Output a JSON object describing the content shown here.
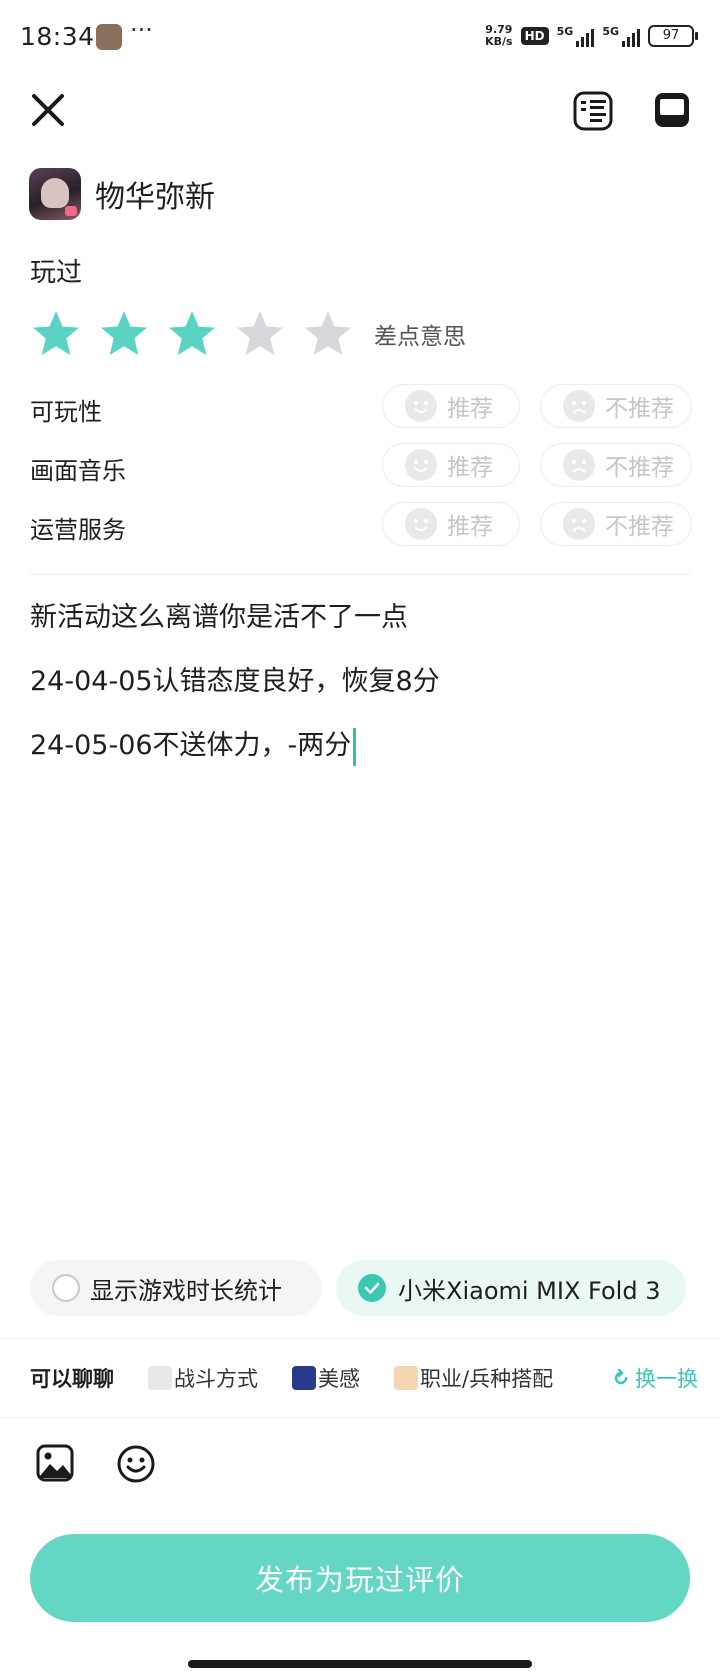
{
  "status_bar": {
    "time": "18:34",
    "more": "···",
    "net_speed_value": "9.79",
    "net_speed_unit": "KB/s",
    "hd_label": "HD",
    "sim1_label": "5G",
    "sim2_label": "5G",
    "battery": "97"
  },
  "header": {
    "close_icon": "close-icon",
    "rules_icon": "rules-icon",
    "draft_icon": "inbox-icon"
  },
  "game": {
    "name": "物华弥新"
  },
  "played_label": "玩过",
  "rating": {
    "stars": 3,
    "max": 5,
    "text": "差点意思",
    "active_color": "#5ad3c2",
    "inactive_color": "#d6d8dc"
  },
  "aspects": [
    {
      "label": "可玩性",
      "recommend": "推荐",
      "not_recommend": "不推荐"
    },
    {
      "label": "画面音乐",
      "recommend": "推荐",
      "not_recommend": "不推荐"
    },
    {
      "label": "运营服务",
      "recommend": "推荐",
      "not_recommend": "不推荐"
    }
  ],
  "review_lines": [
    "新活动这么离谱你是活不了一点",
    "24-04-05认错态度良好，恢复8分",
    "24-05-06不送体力，-两分"
  ],
  "options": {
    "playtime_label": "显示游戏时长统计",
    "device_label": "小米Xiaomi MIX Fold 3"
  },
  "topics": {
    "label": "可以聊聊",
    "items": [
      "战斗方式",
      "美感",
      "职业/兵种搭配"
    ],
    "refresh": "换一换"
  },
  "toolbar": {
    "image_icon": "image-icon",
    "emoji_icon": "emoji-icon"
  },
  "publish_label": "发布为玩过评价",
  "colors": {
    "accent": "#3cc7b4",
    "button": "#63d6c4"
  }
}
